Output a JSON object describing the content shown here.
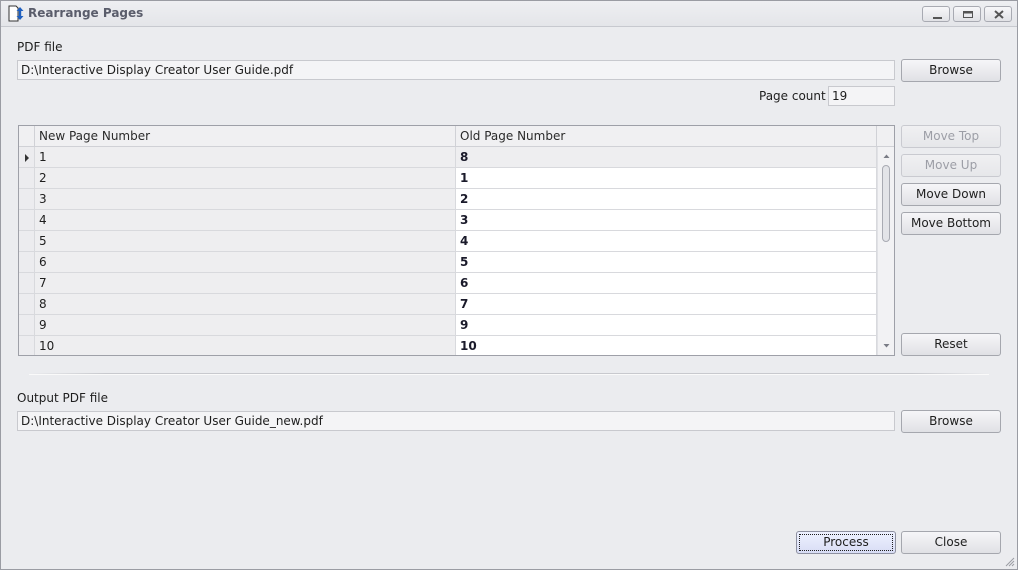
{
  "window": {
    "title": "Rearrange Pages",
    "icon": "rearrange-pages-icon",
    "controls": {
      "minimize": "minimize-icon",
      "maximize": "maximize-icon",
      "close": "close-icon"
    }
  },
  "input": {
    "label": "PDF file",
    "value": "D:\\Interactive Display Creator User Guide.pdf",
    "browse_label": "Browse",
    "page_count_label": "Page count",
    "page_count_value": "19"
  },
  "grid": {
    "columns": [
      "New Page Number",
      "Old Page Number"
    ],
    "current_row_index": 0,
    "rows": [
      {
        "new": "1",
        "old": "8"
      },
      {
        "new": "2",
        "old": "1"
      },
      {
        "new": "3",
        "old": "2"
      },
      {
        "new": "4",
        "old": "3"
      },
      {
        "new": "5",
        "old": "4"
      },
      {
        "new": "6",
        "old": "5"
      },
      {
        "new": "7",
        "old": "6"
      },
      {
        "new": "8",
        "old": "7"
      },
      {
        "new": "9",
        "old": "9"
      },
      {
        "new": "10",
        "old": "10"
      }
    ]
  },
  "actions": {
    "move_top": "Move Top",
    "move_up": "Move Up",
    "move_down": "Move Down",
    "move_bottom": "Move Bottom",
    "reset": "Reset"
  },
  "output": {
    "label": "Output PDF file",
    "value": "D:\\Interactive Display Creator User Guide_new.pdf",
    "browse_label": "Browse"
  },
  "footer": {
    "process_label": "Process",
    "close_label": "Close"
  },
  "colors": {
    "accent_blue": "#1f5fbf",
    "focused_button": "#dde3fa"
  }
}
